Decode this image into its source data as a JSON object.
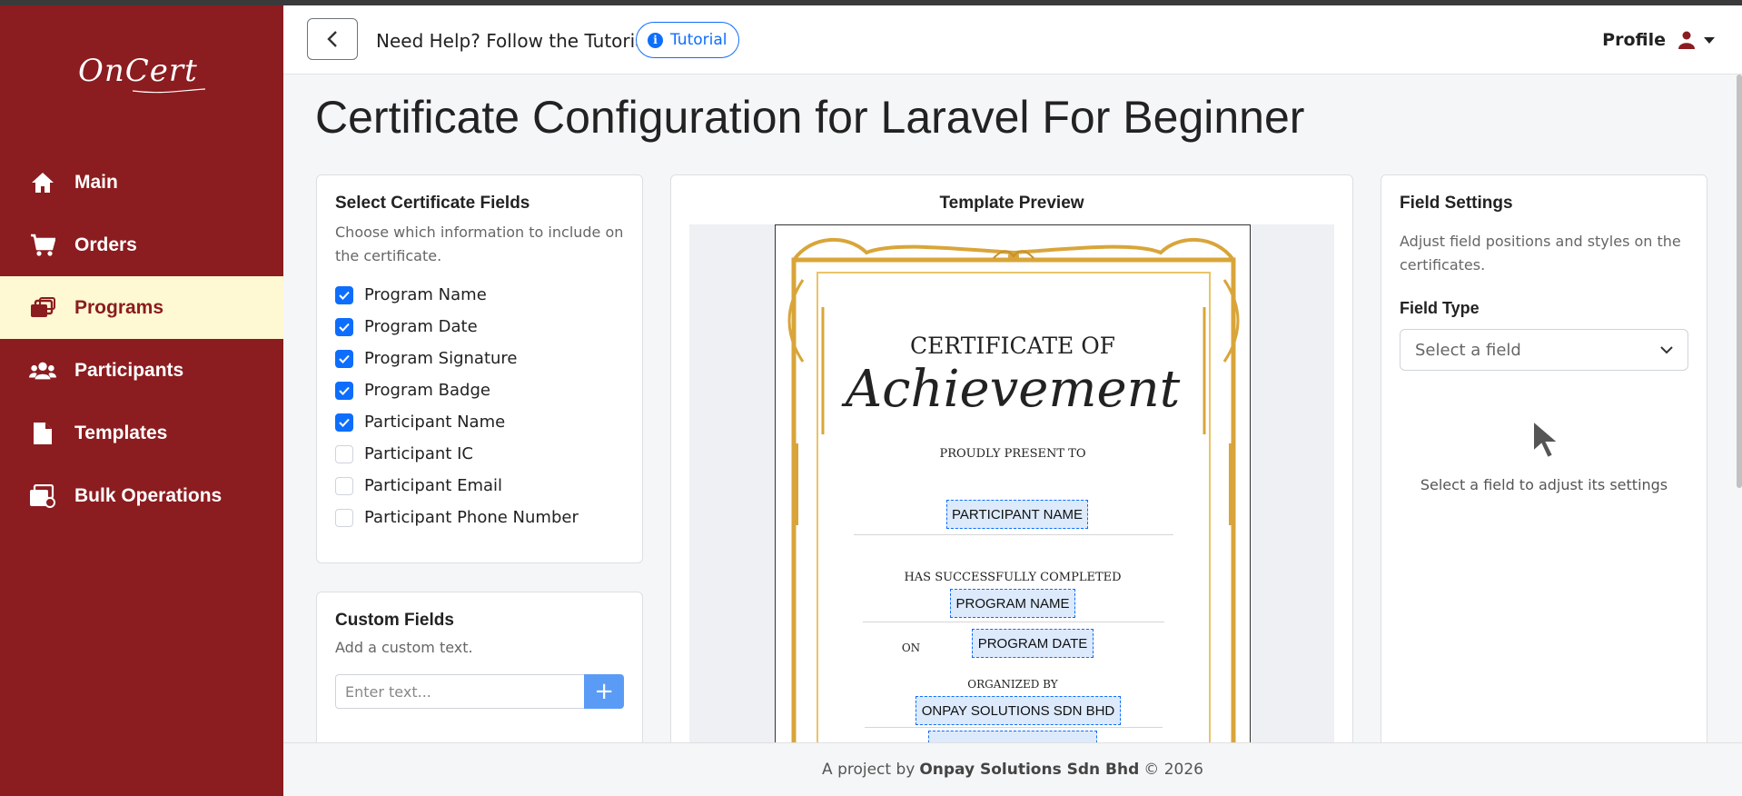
{
  "sidebar": {
    "logo_text": "OnCert",
    "items": [
      {
        "label": "Main",
        "icon": "home-icon",
        "active": false
      },
      {
        "label": "Orders",
        "icon": "cart-icon",
        "active": false
      },
      {
        "label": "Programs",
        "icon": "programs-icon",
        "active": true
      },
      {
        "label": "Participants",
        "icon": "users-icon",
        "active": false
      },
      {
        "label": "Templates",
        "icon": "file-icon",
        "active": false
      },
      {
        "label": "Bulk Operations",
        "icon": "bulk-icon",
        "active": false
      }
    ]
  },
  "header": {
    "help_text": "Need Help? Follow the Tutorial",
    "tutorial_label": "Tutorial",
    "profile_label": "Profile"
  },
  "page": {
    "title": "Certificate Configuration for Laravel For Beginner"
  },
  "fields_card": {
    "title": "Select Certificate Fields",
    "description": "Choose which information to include on the certificate.",
    "options": [
      {
        "label": "Program Name",
        "checked": true
      },
      {
        "label": "Program Date",
        "checked": true
      },
      {
        "label": "Program Signature",
        "checked": true
      },
      {
        "label": "Program Badge",
        "checked": true
      },
      {
        "label": "Participant Name",
        "checked": true
      },
      {
        "label": "Participant IC",
        "checked": false
      },
      {
        "label": "Participant Email",
        "checked": false
      },
      {
        "label": "Participant Phone Number",
        "checked": false
      }
    ]
  },
  "custom_card": {
    "title": "Custom Fields",
    "description": "Add a custom text.",
    "input_placeholder": "Enter text...",
    "add_symbol": "+"
  },
  "preview_card": {
    "title": "Template Preview",
    "certificate": {
      "heading": "CERTIFICATE OF",
      "script_title": "Achievement",
      "present_line": "PROUDLY PRESENT TO",
      "participant_field": "PARTICIPANT NAME",
      "completed_line": "HAS SUCCESSFULLY COMPLETED",
      "program_field": "PROGRAM NAME",
      "on_label": "ON",
      "date_field": "PROGRAM DATE",
      "organized_line": "ORGANIZED BY",
      "organizer_field": "ONPAY SOLUTIONS SDN BHD"
    }
  },
  "settings_card": {
    "title": "Field Settings",
    "description": "Adjust field positions and styles on the certificates.",
    "field_type_label": "Field Type",
    "select_placeholder": "Select a field",
    "hint": "Select a field to adjust its settings"
  },
  "footer": {
    "prefix": "A project by",
    "company": "Onpay Solutions Sdn Bhd",
    "suffix": "© 2026"
  },
  "colors": {
    "sidebar_bg": "#8b1c1f",
    "active_bg": "#fef8d3",
    "primary": "#0d6efd",
    "gold": "#d9a53a"
  }
}
